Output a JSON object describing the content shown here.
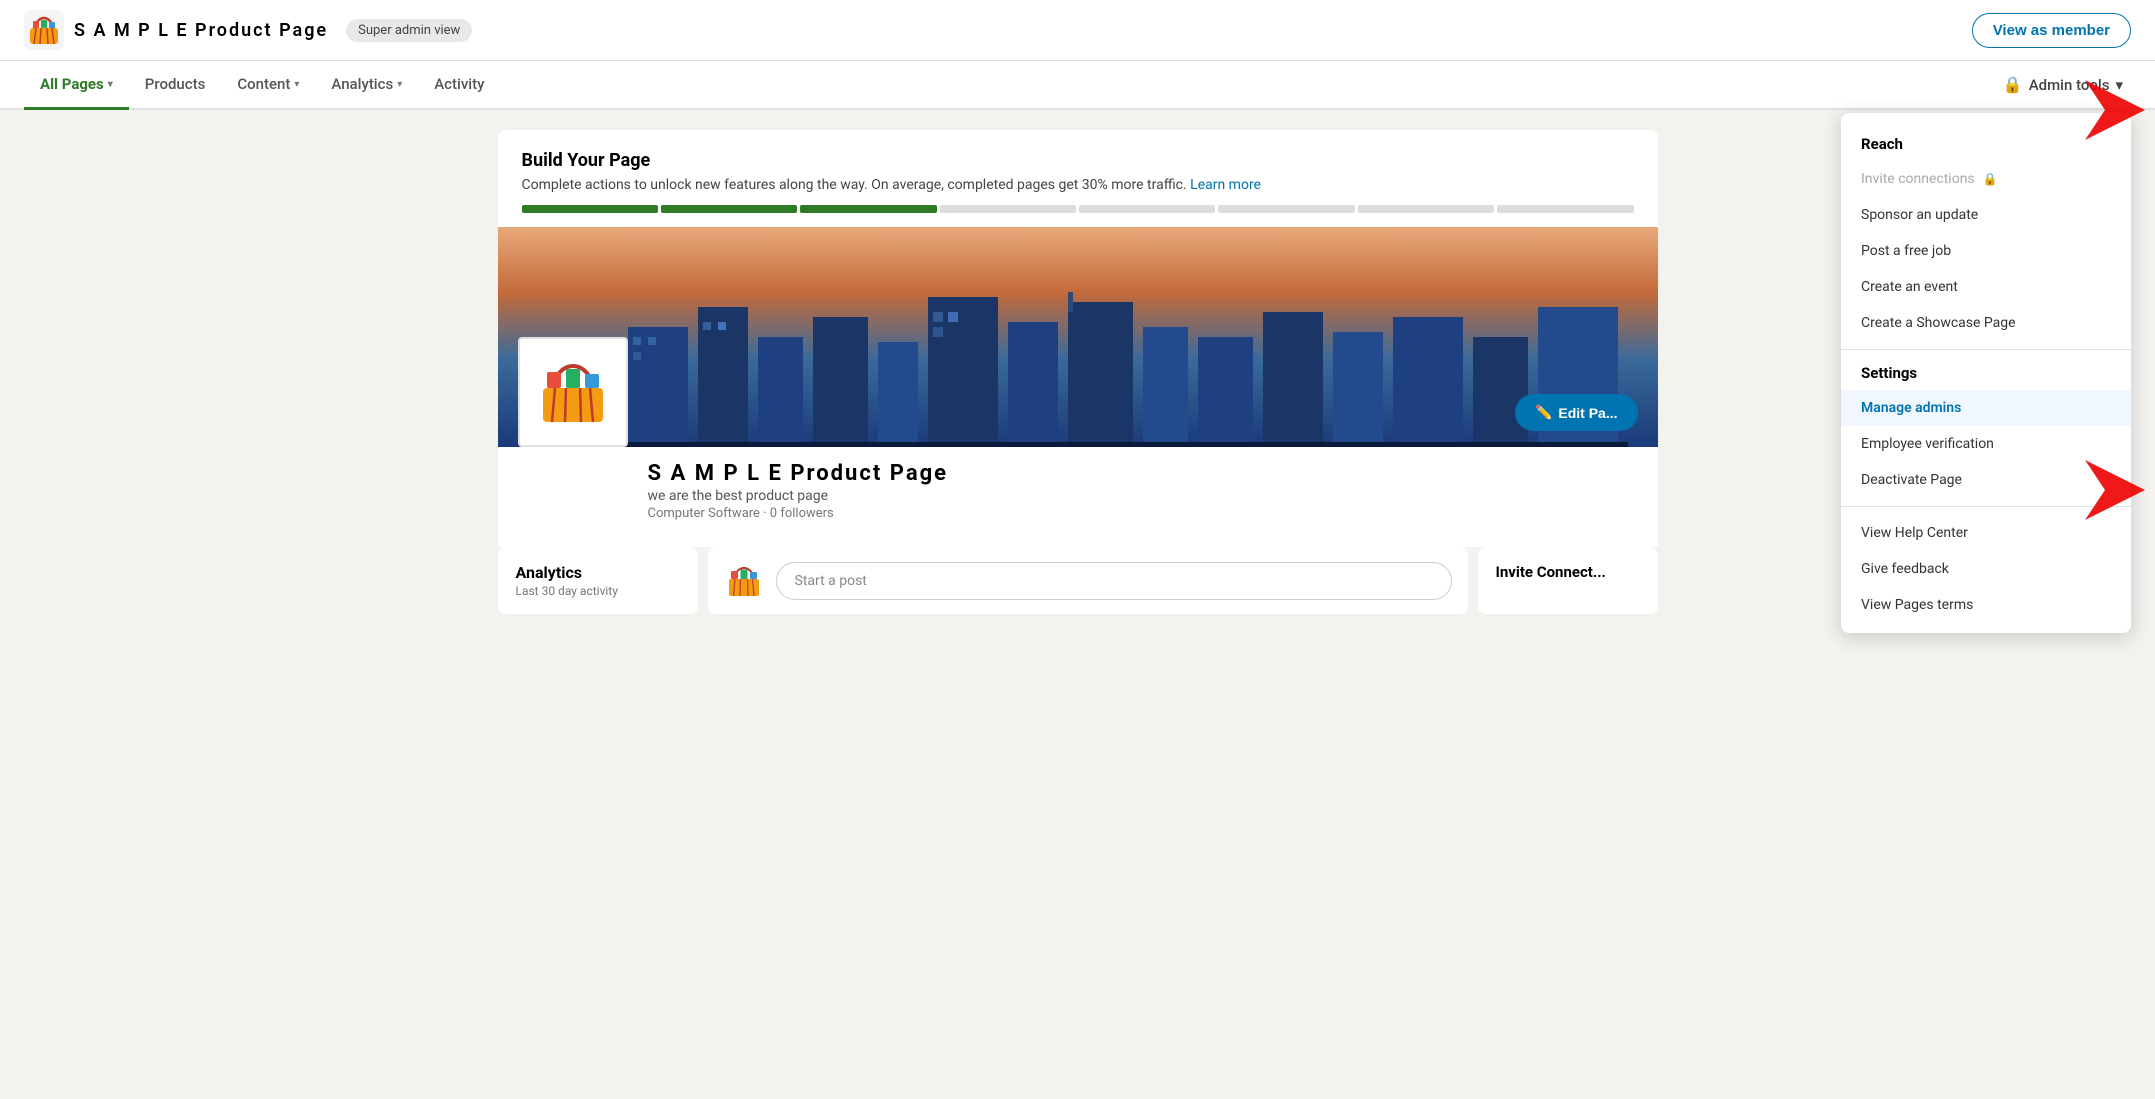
{
  "header": {
    "brand_name": "S A M P L E Product Page",
    "super_admin_label": "Super admin view",
    "view_as_member_label": "View as member"
  },
  "nav": {
    "items": [
      {
        "label": "All Pages",
        "active": true,
        "has_dropdown": true
      },
      {
        "label": "Products",
        "active": false,
        "has_dropdown": false
      },
      {
        "label": "Content",
        "active": false,
        "has_dropdown": true
      },
      {
        "label": "Analytics",
        "active": false,
        "has_dropdown": true
      },
      {
        "label": "Activity",
        "active": false,
        "has_dropdown": false
      }
    ],
    "admin_tools_label": "Admin tools"
  },
  "build_page": {
    "title": "Build Your Page",
    "description": "Complete actions to unlock new features along the way. On average, completed pages get 30% more traffic.",
    "learn_more": "Learn more",
    "progress_filled": 3,
    "progress_total": 8
  },
  "company": {
    "name": "S A M P L E Product Page",
    "tagline": "we are the best product page",
    "meta": "Computer Software · 0 followers",
    "edit_page_label": "Edit Pa..."
  },
  "analytics_card": {
    "title": "Analytics",
    "subtitle": "Last 30 day activity"
  },
  "post_card": {
    "placeholder": "Start a post"
  },
  "invite_card": {
    "title": "Invite Connect..."
  },
  "dropdown_menu": {
    "reach_section": "Reach",
    "items": [
      {
        "label": "Invite connections",
        "disabled": true,
        "has_lock": true,
        "active": false
      },
      {
        "label": "Sponsor an update",
        "disabled": false,
        "active": false
      },
      {
        "label": "Post a free job",
        "disabled": false,
        "active": false
      },
      {
        "label": "Create an event",
        "disabled": false,
        "active": false
      },
      {
        "label": "Create a Showcase Page",
        "disabled": false,
        "active": false
      }
    ],
    "settings_section": "Settings",
    "settings_items": [
      {
        "label": "Manage admins",
        "disabled": false,
        "active": true
      },
      {
        "label": "Employee verification",
        "disabled": false,
        "active": false
      },
      {
        "label": "Deactivate Page",
        "disabled": false,
        "active": false
      }
    ],
    "footer_items": [
      {
        "label": "View Help Center"
      },
      {
        "label": "Give feedback"
      },
      {
        "label": "View Pages terms"
      }
    ]
  },
  "icons": {
    "basket": "🧺",
    "lock": "🔒",
    "pencil": "✏️",
    "chevron_down": "▾"
  }
}
